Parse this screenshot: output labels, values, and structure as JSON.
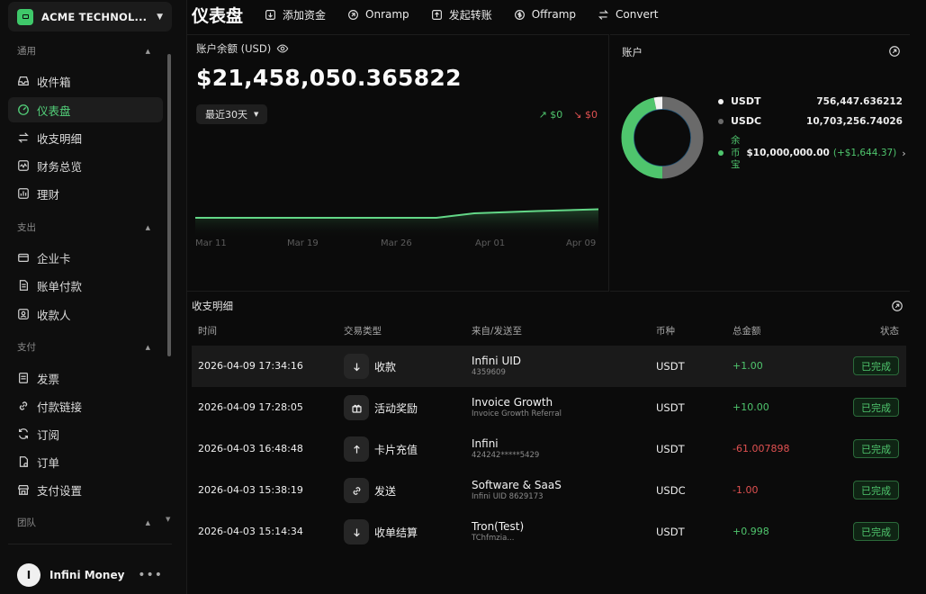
{
  "org": {
    "name": "ACME TECHNOL..."
  },
  "sidebar": {
    "sections": [
      {
        "label": "通用",
        "items": [
          {
            "label": "收件箱",
            "icon": "inbox-icon"
          },
          {
            "label": "仪表盘",
            "icon": "dashboard-icon",
            "active": true
          },
          {
            "label": "收支明细",
            "icon": "transfer-icon"
          },
          {
            "label": "财务总览",
            "icon": "finance-icon"
          },
          {
            "label": "理财",
            "icon": "invest-icon"
          }
        ]
      },
      {
        "label": "支出",
        "items": [
          {
            "label": "企业卡",
            "icon": "card-icon"
          },
          {
            "label": "账单付款",
            "icon": "bill-icon"
          },
          {
            "label": "收款人",
            "icon": "payee-icon"
          }
        ]
      },
      {
        "label": "支付",
        "items": [
          {
            "label": "发票",
            "icon": "invoice-icon"
          },
          {
            "label": "付款链接",
            "icon": "link-icon"
          },
          {
            "label": "订阅",
            "icon": "refresh-icon"
          },
          {
            "label": "订单",
            "icon": "order-icon"
          },
          {
            "label": "支付设置",
            "icon": "store-icon"
          }
        ]
      },
      {
        "label": "团队",
        "items": []
      }
    ]
  },
  "user": {
    "initial": "I",
    "name": "Infini Money",
    "more": "•••"
  },
  "header": {
    "title": "仪表盘",
    "actions": [
      {
        "label": "添加资金",
        "icon": "add-funds-icon"
      },
      {
        "label": "Onramp",
        "icon": "onramp-icon"
      },
      {
        "label": "发起转账",
        "icon": "transfer-out-icon"
      },
      {
        "label": "Offramp",
        "icon": "offramp-icon"
      },
      {
        "label": "Convert",
        "icon": "convert-icon"
      }
    ]
  },
  "balance": {
    "label": "账户余额 (USD)",
    "value": "$21,458,050.365822",
    "range": "最近30天",
    "inflow": "$0",
    "outflow": "$0"
  },
  "chart_data": {
    "type": "area",
    "x_labels": [
      "Mar 11",
      "Mar 19",
      "Mar 26",
      "Apr 01",
      "Apr 09"
    ],
    "trend": "flat, slight rise after Mar 26",
    "colors": {
      "line": "#63d787"
    }
  },
  "accounts": {
    "title": "账户",
    "items": [
      {
        "name": "USDT",
        "value": "756,447.636212",
        "color": "#f2f2f2",
        "fraction": 0.035
      },
      {
        "name": "USDC",
        "value": "10,703,256.74026",
        "color": "#6a6a6a",
        "fraction": 0.499
      }
    ],
    "yuebao": {
      "name": "余币宝",
      "value": "$10,000,000.00",
      "gain": "(+$1,644.37)",
      "color": "#4fc56d",
      "fraction": 0.466
    }
  },
  "transactions": {
    "title": "收支明细",
    "columns": [
      "时间",
      "交易类型",
      "来自/发送至",
      "币种",
      "总金额",
      "状态"
    ],
    "rows": [
      {
        "time": "2026-04-09 17:34:16",
        "type": "收款",
        "icon": "arrow-down-icon",
        "from": "Infini UID",
        "sub": "4359609",
        "currency": "USDT",
        "amount": "+1.00",
        "sign": "pos",
        "status": "已完成"
      },
      {
        "time": "2026-04-09 17:28:05",
        "type": "活动奖励",
        "icon": "gift-icon",
        "from": "Invoice Growth",
        "sub": "Invoice Growth Referral",
        "currency": "USDT",
        "amount": "+10.00",
        "sign": "pos",
        "status": "已完成"
      },
      {
        "time": "2026-04-03 16:48:48",
        "type": "卡片充值",
        "icon": "arrow-up-icon",
        "from": "Infini",
        "sub": "424242*****5429",
        "currency": "USDT",
        "amount": "-61.007898",
        "sign": "neg",
        "status": "已完成"
      },
      {
        "time": "2026-04-03 15:38:19",
        "type": "发送",
        "icon": "link-icon",
        "from": "Software & SaaS",
        "sub": "Infini UID 8629173",
        "currency": "USDC",
        "amount": "-1.00",
        "sign": "neg",
        "status": "已完成"
      },
      {
        "time": "2026-04-03 15:14:34",
        "type": "收单结算",
        "icon": "arrow-down-icon",
        "from": "Tron(Test)",
        "sub": "TChfmzia...",
        "currency": "USDT",
        "amount": "+0.998",
        "sign": "pos",
        "status": "已完成"
      }
    ]
  }
}
